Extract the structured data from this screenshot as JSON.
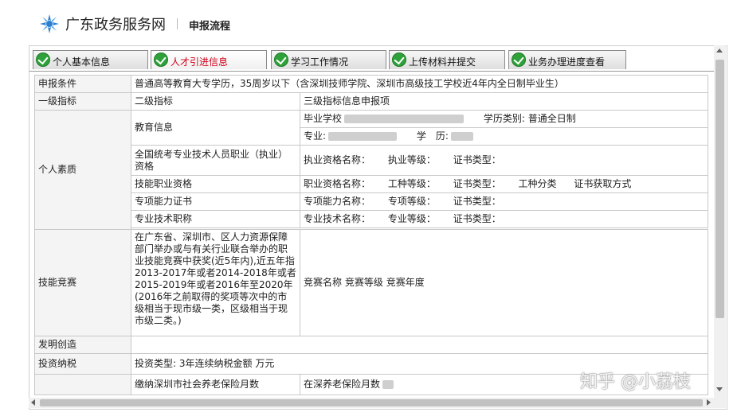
{
  "header": {
    "site_name": "广东政务服务网",
    "page_title": "申报流程"
  },
  "tabs": [
    {
      "label": "个人基本信息",
      "active": false
    },
    {
      "label": "人才引进信息",
      "active": true
    },
    {
      "label": "学习工作情况",
      "active": false
    },
    {
      "label": "上传材料并提交",
      "active": false
    },
    {
      "label": "业务办理进度查看",
      "active": false
    }
  ],
  "table": {
    "r_condition": {
      "label": "申报条件",
      "value": "普通高等教育大专学历，35周岁以下（含深圳技师学院、深圳市高级技工学校近4年内全日制毕业生）"
    },
    "r_header": {
      "c1": "一级指标",
      "c2": "二级指标",
      "c3": "三级指标信息申报项"
    },
    "quality": {
      "label": "个人素质",
      "education": {
        "label": "教育信息",
        "school": "毕业学校",
        "edu_type_label": "学历类别:",
        "edu_type_value": "普通全日制",
        "major": "专业:",
        "degree": "学　历:"
      },
      "cert": {
        "label": "全国统考专业技术人员职业（执业）资格",
        "v1": "执业资格名称：",
        "v2": "执业等级：",
        "v3": "证书类型："
      },
      "skill": {
        "label": "技能职业资格",
        "v1": "职业资格名称：",
        "v2": "工种等级：",
        "v3": "证书类型：",
        "v4": "工种分类",
        "v5": "证书获取方式"
      },
      "special": {
        "label": "专项能力证书",
        "v1": "专项能力名称：",
        "v2": "专项等级：",
        "v3": "证书类型："
      },
      "title": {
        "label": "专业技术职称",
        "v1": "专业技术名称：",
        "v2": "专业等级：",
        "v3": "证书类型："
      }
    },
    "competition": {
      "label": "技能竞赛",
      "desc": "在广东省、深圳市、区人力资源保障部门举办或与有关行业联合举办的职业技能竞赛中获奖(近5年内),近五年指2013-2017年或者2014-2018年或者2015-2019年或者2016年至2020年(2016年之前取得的奖项等次中的市级相当于现市级一类，区级相当于现市级二类。)",
      "v1": "竞赛名称",
      "v2": "竞赛等级",
      "v3": "竞赛年度"
    },
    "invention": {
      "label": "发明创造"
    },
    "tax": {
      "label": "投资纳税",
      "v1": "投资类型:",
      "v2": "3年连续纳税金额",
      "v3": "万元"
    },
    "pension": {
      "label": "缴纳深圳市社会养老保险月数",
      "value": "在深养老保险月数"
    }
  },
  "watermark": "知乎 @小荔枝",
  "colors": {
    "active_tab_text": "#d0021b",
    "check_green": "#2fa13a",
    "logo_blue": "#2b7fd0"
  },
  "icons": {
    "logo": "guangdong-gov-logo-icon",
    "tab_check": "green-check-icon"
  }
}
